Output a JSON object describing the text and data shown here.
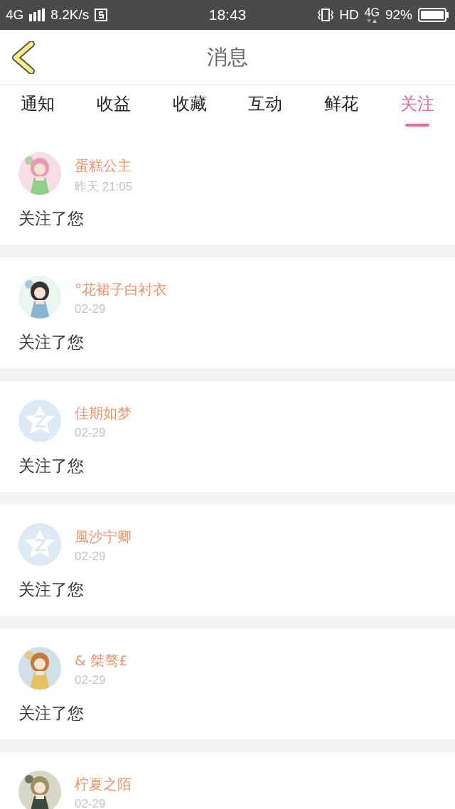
{
  "status_bar": {
    "network": "4G",
    "speed": "8.2K/s",
    "time": "18:43",
    "hd": "HD",
    "network_right": "4G",
    "battery": "92%"
  },
  "header": {
    "title": "消息"
  },
  "tabs": [
    {
      "label": "通知",
      "selected": false
    },
    {
      "label": "收益",
      "selected": false
    },
    {
      "label": "收藏",
      "selected": false
    },
    {
      "label": "互动",
      "selected": false
    },
    {
      "label": "鲜花",
      "selected": false
    },
    {
      "label": "关注",
      "selected": true
    }
  ],
  "messages": [
    {
      "name": "蛋糕公主",
      "time": "昨天 21:05",
      "text": "关注了您"
    },
    {
      "name": "°花裙子白衬衣",
      "time": "02-29",
      "text": "关注了您"
    },
    {
      "avatar": {
        "kind": "default"
      },
      "name": "佳期如梦",
      "time": "02-29",
      "text": "关注了您"
    },
    {
      "avatar": {
        "kind": "default"
      },
      "name": "風沙宁卿",
      "time": "02-29",
      "text": "关注了您"
    },
    {
      "name": "& 桀骜£",
      "time": "02-29",
      "text": "关注了您"
    },
    {
      "name": "柠夏之陌",
      "time": "02-29"
    }
  ]
}
